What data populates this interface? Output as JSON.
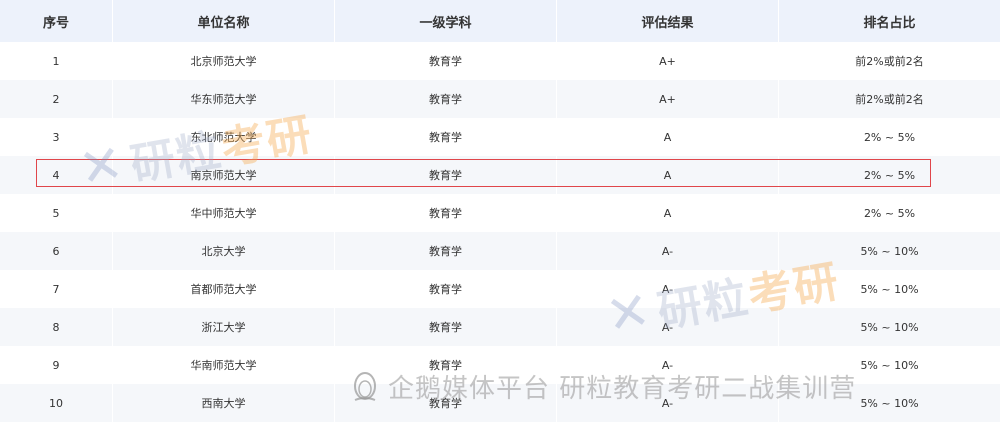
{
  "table": {
    "headers": [
      "序号",
      "单位名称",
      "一级学科",
      "评估结果",
      "排名占比"
    ],
    "rows": [
      {
        "no": "1",
        "unit": "北京师范大学",
        "subject": "教育学",
        "result": "A+",
        "ratio": "前2%或前2名"
      },
      {
        "no": "2",
        "unit": "华东师范大学",
        "subject": "教育学",
        "result": "A+",
        "ratio": "前2%或前2名"
      },
      {
        "no": "3",
        "unit": "东北师范大学",
        "subject": "教育学",
        "result": "A",
        "ratio": "2% ~ 5%"
      },
      {
        "no": "4",
        "unit": "南京师范大学",
        "subject": "教育学",
        "result": "A",
        "ratio": "2% ~ 5%"
      },
      {
        "no": "5",
        "unit": "华中师范大学",
        "subject": "教育学",
        "result": "A",
        "ratio": "2% ~ 5%"
      },
      {
        "no": "6",
        "unit": "北京大学",
        "subject": "教育学",
        "result": "A-",
        "ratio": "5% ~ 10%"
      },
      {
        "no": "7",
        "unit": "首都师范大学",
        "subject": "教育学",
        "result": "A-",
        "ratio": "5% ~ 10%"
      },
      {
        "no": "8",
        "unit": "浙江大学",
        "subject": "教育学",
        "result": "A-",
        "ratio": "5% ~ 10%"
      },
      {
        "no": "9",
        "unit": "华南师范大学",
        "subject": "教育学",
        "result": "A-",
        "ratio": "5% ~ 10%"
      },
      {
        "no": "10",
        "unit": "西南大学",
        "subject": "教育学",
        "result": "A-",
        "ratio": "5% ~ 10%"
      }
    ]
  },
  "highlight_color": "#e0464a",
  "watermarks": {
    "brand_a": "研粒",
    "brand_b": "考研",
    "footer_text": "企鹅媒体平台 研粒教育考研二战集训营",
    "footer_icon": "penguin-icon"
  }
}
